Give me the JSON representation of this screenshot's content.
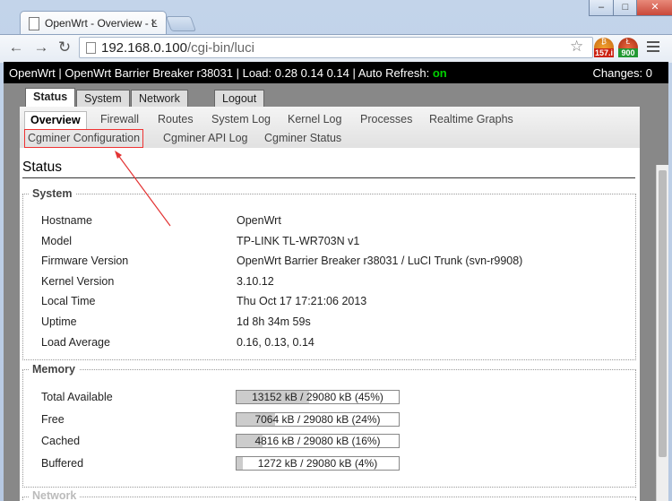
{
  "browser": {
    "tab_title": "OpenWrt - Overview - L",
    "tab_close": "×",
    "url_host": "192.168.0.100",
    "url_path": "/cgi-bin/luci",
    "ext1_badge": "157.i",
    "ext2_badge": "900",
    "win_min": "–",
    "win_max": "□",
    "win_close": "✕"
  },
  "header": {
    "left": "OpenWrt | OpenWrt Barrier Breaker r38031 | Load: 0.28 0.14 0.14 | Auto Refresh: ",
    "refresh": "on",
    "changes": "Changes: 0"
  },
  "main_tabs": [
    "Status",
    "System",
    "Network",
    "Logout"
  ],
  "sub_tabs_row1": [
    "Overview",
    "Firewall",
    "Routes",
    "System Log",
    "Kernel Log",
    "Processes",
    "Realtime Graphs"
  ],
  "sub_tabs_row2": [
    "Cgminer Configuration",
    "Cgminer API Log",
    "Cgminer Status"
  ],
  "content": {
    "title": "Status",
    "system": {
      "legend": "System",
      "rows": [
        {
          "label": "Hostname",
          "value": "OpenWrt"
        },
        {
          "label": "Model",
          "value": "TP-LINK TL-WR703N v1"
        },
        {
          "label": "Firmware Version",
          "value": "OpenWrt Barrier Breaker r38031 / LuCI Trunk (svn-r9908)"
        },
        {
          "label": "Kernel Version",
          "value": "3.10.12"
        },
        {
          "label": "Local Time",
          "value": "Thu Oct 17 17:21:06 2013"
        },
        {
          "label": "Uptime",
          "value": "1d 8h 34m 59s"
        },
        {
          "label": "Load Average",
          "value": "0.16, 0.13, 0.14"
        }
      ]
    },
    "memory": {
      "legend": "Memory",
      "rows": [
        {
          "label": "Total Available",
          "value": "13152 kB / 29080 kB (45%)",
          "fraction": 0.45
        },
        {
          "label": "Free",
          "value": "7064 kB / 29080 kB (24%)",
          "fraction": 0.24
        },
        {
          "label": "Cached",
          "value": "4816 kB / 29080 kB (16%)",
          "fraction": 0.16
        },
        {
          "label": "Buffered",
          "value": "1272 kB / 29080 kB (4%)",
          "fraction": 0.04
        }
      ]
    },
    "network_legend": "Network"
  },
  "colors": {
    "highlight": "#e33333",
    "refresh_on": "#00d000",
    "arrow": "#e33333"
  }
}
